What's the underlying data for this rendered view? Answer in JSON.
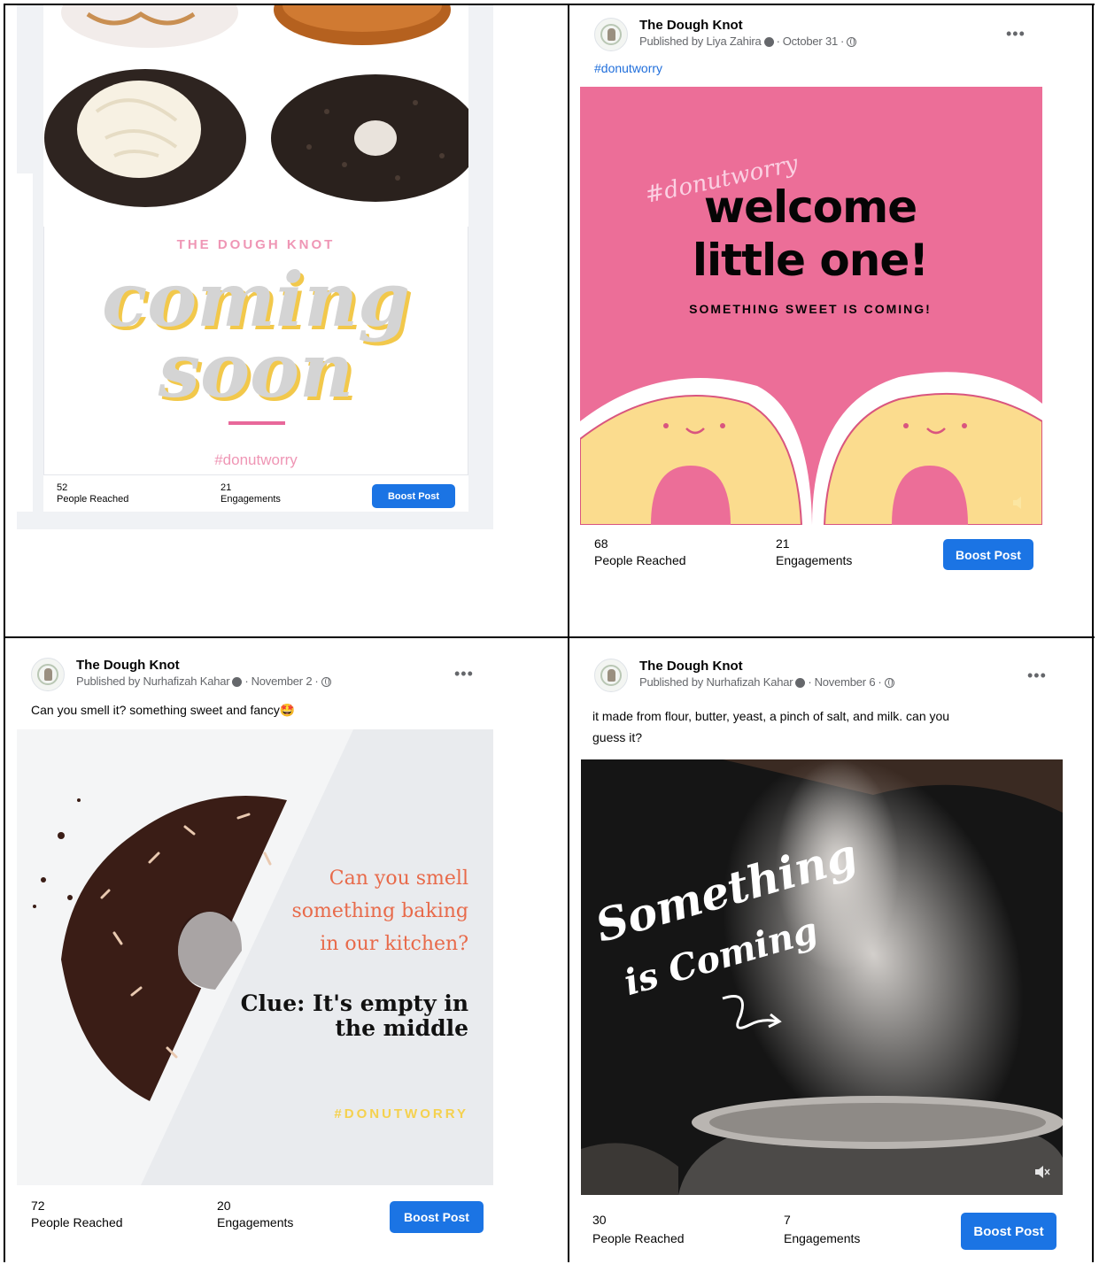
{
  "posts": [
    {
      "image": {
        "brand": "THE DOUGH KNOT",
        "headline_line1": "coming",
        "headline_line2": "soon",
        "hashtag": "#donutworry"
      },
      "stats": {
        "reached_value": "52",
        "reached_label": "People Reached",
        "engagements_value": "21",
        "engagements_label": "Engagements"
      },
      "boost_label": "Boost Post"
    },
    {
      "page_name": "The Dough Knot",
      "publisher": "Published by Liya Zahira",
      "date": "October 31",
      "hashtag_link": "#donutworry",
      "image": {
        "script_tag": "#donutworry",
        "title_line1": "welcome",
        "title_line2": "little one!",
        "subtitle": "SOMETHING SWEET IS COMING!"
      },
      "stats": {
        "reached_value": "68",
        "reached_label": "People Reached",
        "engagements_value": "21",
        "engagements_label": "Engagements"
      },
      "boost_label": "Boost Post"
    },
    {
      "page_name": "The Dough Knot",
      "publisher": "Published by Nurhafizah Kahar",
      "date": "November 2",
      "caption": "Can you smell it? something sweet and fancy🤩",
      "image": {
        "question_line1": "Can you smell",
        "question_line2": "something baking",
        "question_line3": "in our kitchen?",
        "clue_line1": "Clue: It's empty in",
        "clue_line2": "the middle",
        "hashtag": "#DONUTWORRY"
      },
      "stats": {
        "reached_value": "72",
        "reached_label": "People Reached",
        "engagements_value": "20",
        "engagements_label": "Engagements"
      },
      "boost_label": "Boost Post"
    },
    {
      "page_name": "The Dough Knot",
      "publisher": "Published by Nurhafizah Kahar",
      "date": "November 6",
      "caption_line1": "it made from flour, butter, yeast, a pinch of salt, and milk. can you",
      "caption_line2": "guess it?",
      "image": {
        "line1": "Something",
        "line2": "is Coming"
      },
      "stats": {
        "reached_value": "30",
        "reached_label": "People Reached",
        "engagements_value": "7",
        "engagements_label": "Engagements"
      },
      "boost_label": "Boost Post"
    }
  ],
  "icons": {
    "more": "more-horizontal-icon",
    "globe": "globe-icon",
    "info": "info-icon",
    "mute": "volume-mute-icon"
  },
  "colors": {
    "boost_button": "#1b74e4",
    "pink_art": "#ec6e98",
    "hashtag_link": "#216fdb"
  }
}
